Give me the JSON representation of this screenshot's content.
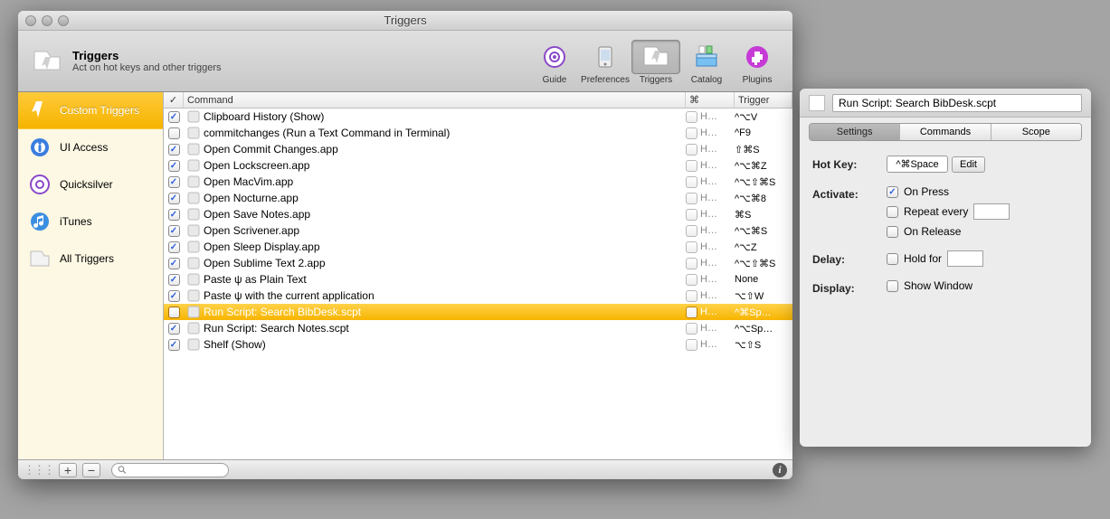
{
  "window": {
    "title": "Triggers",
    "header_title": "Triggers",
    "header_sub": "Act on hot keys and other triggers"
  },
  "toolbar": [
    {
      "id": "guide",
      "label": "Guide",
      "pressed": false
    },
    {
      "id": "preferences",
      "label": "Preferences",
      "pressed": false
    },
    {
      "id": "triggers",
      "label": "Triggers",
      "pressed": true
    },
    {
      "id": "catalog",
      "label": "Catalog",
      "pressed": false
    },
    {
      "id": "plugins",
      "label": "Plugins",
      "pressed": false
    }
  ],
  "sidebar": [
    {
      "id": "custom",
      "label": "Custom Triggers",
      "selected": true
    },
    {
      "id": "ui",
      "label": "UI Access",
      "selected": false
    },
    {
      "id": "qs",
      "label": "Quicksilver",
      "selected": false
    },
    {
      "id": "itunes",
      "label": "iTunes",
      "selected": false
    },
    {
      "id": "all",
      "label": "All Triggers",
      "selected": false
    }
  ],
  "columns": {
    "check": "✓",
    "command": "Command",
    "scope": "⌘",
    "trigger": "Trigger"
  },
  "rows": [
    {
      "checked": true,
      "label": "Clipboard History (Show)",
      "scope": "H…",
      "trigger": "^⌥V",
      "selected": false
    },
    {
      "checked": false,
      "label": "commitchanges (Run a Text Command in Terminal)",
      "scope": "H…",
      "trigger": "^F9",
      "selected": false
    },
    {
      "checked": true,
      "label": "Open Commit Changes.app",
      "scope": "H…",
      "trigger": "⇧⌘S",
      "selected": false
    },
    {
      "checked": true,
      "label": "Open Lockscreen.app",
      "scope": "H…",
      "trigger": "^⌥⌘Z",
      "selected": false
    },
    {
      "checked": true,
      "label": "Open MacVim.app",
      "scope": "H…",
      "trigger": "^⌥⇧⌘S",
      "selected": false
    },
    {
      "checked": true,
      "label": "Open Nocturne.app",
      "scope": "H…",
      "trigger": "^⌥⌘8",
      "selected": false
    },
    {
      "checked": true,
      "label": "Open Save Notes.app",
      "scope": "H…",
      "trigger": "⌘S",
      "selected": false
    },
    {
      "checked": true,
      "label": "Open Scrivener.app",
      "scope": "H…",
      "trigger": "^⌥⌘S",
      "selected": false
    },
    {
      "checked": true,
      "label": "Open Sleep Display.app",
      "scope": "H…",
      "trigger": "^⌥Z",
      "selected": false
    },
    {
      "checked": true,
      "label": "Open Sublime Text 2.app",
      "scope": "H…",
      "trigger": "^⌥⇧⌘S",
      "selected": false
    },
    {
      "checked": true,
      "label": "Paste ψ as Plain Text",
      "scope": "H…",
      "trigger": "None",
      "selected": false
    },
    {
      "checked": true,
      "label": "Paste ψ with the current application",
      "scope": "H…",
      "trigger": "⌥⇧W",
      "selected": false
    },
    {
      "checked": true,
      "label": "Run Script: Search BibDesk.scpt",
      "scope": "H…",
      "trigger": "^⌘Sp…",
      "selected": true
    },
    {
      "checked": true,
      "label": "Run Script: Search Notes.scpt",
      "scope": "H…",
      "trigger": "^⌥Sp…",
      "selected": false
    },
    {
      "checked": true,
      "label": "Shelf (Show)",
      "scope": "H…",
      "trigger": "⌥⇧S",
      "selected": false
    }
  ],
  "footer": {
    "add": "+",
    "remove": "−",
    "search_placeholder": ""
  },
  "inspector": {
    "title_value": "Run Script: Search BibDesk.scpt",
    "tabs": [
      {
        "label": "Settings",
        "active": true
      },
      {
        "label": "Commands",
        "active": false
      },
      {
        "label": "Scope",
        "active": false
      }
    ],
    "hotkey_label": "Hot Key:",
    "hotkey_value": "^⌘Space",
    "edit_label": "Edit",
    "activate_label": "Activate:",
    "onpress": {
      "label": "On Press",
      "checked": true
    },
    "repeat": {
      "label": "Repeat every",
      "checked": false,
      "value": ""
    },
    "onrelease": {
      "label": "On Release",
      "checked": false
    },
    "delay_label": "Delay:",
    "holdfor": {
      "label": "Hold for",
      "checked": false,
      "value": ""
    },
    "display_label": "Display:",
    "showwin": {
      "label": "Show Window",
      "checked": false
    }
  }
}
